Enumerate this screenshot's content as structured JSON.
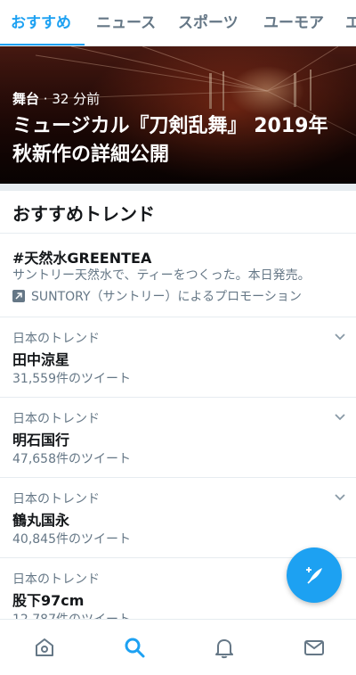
{
  "tabs": [
    "おすすめ",
    "ニュース",
    "スポーツ",
    "ユーモア",
    "エ"
  ],
  "hero": {
    "category": "舞台",
    "time": "32 分前",
    "separator": " · ",
    "title": "ミュージカル『刀剣乱舞』 2019年秋新作の詳細公開"
  },
  "section_title": "おすすめトレンド",
  "promoted": {
    "hashtag": "#天然水GREENTEA",
    "description": "サントリー天然水で、ティーをつくった。本日発売。",
    "promoted_by": "SUNTORY（サントリー）によるプロモーション"
  },
  "trends": [
    {
      "context": "日本のトレンド",
      "name": "田中涼星",
      "count": "31,559件のツイート"
    },
    {
      "context": "日本のトレンド",
      "name": "明石国行",
      "count": "47,658件のツイート"
    },
    {
      "context": "日本のトレンド",
      "name": "鶴丸国永",
      "count": "40,845件のツイート"
    },
    {
      "context": "日本のトレンド",
      "name": "股下97cm",
      "count": "12,787件のツイート"
    }
  ],
  "colors": {
    "accent": "#1da1f2",
    "muted": "#657786",
    "text": "#14171a"
  },
  "icons": {
    "fab": "compose-tweet-icon",
    "nav": [
      "home-icon",
      "search-icon",
      "notifications-bell-icon",
      "messages-mail-icon"
    ],
    "active_nav": "search-icon"
  }
}
